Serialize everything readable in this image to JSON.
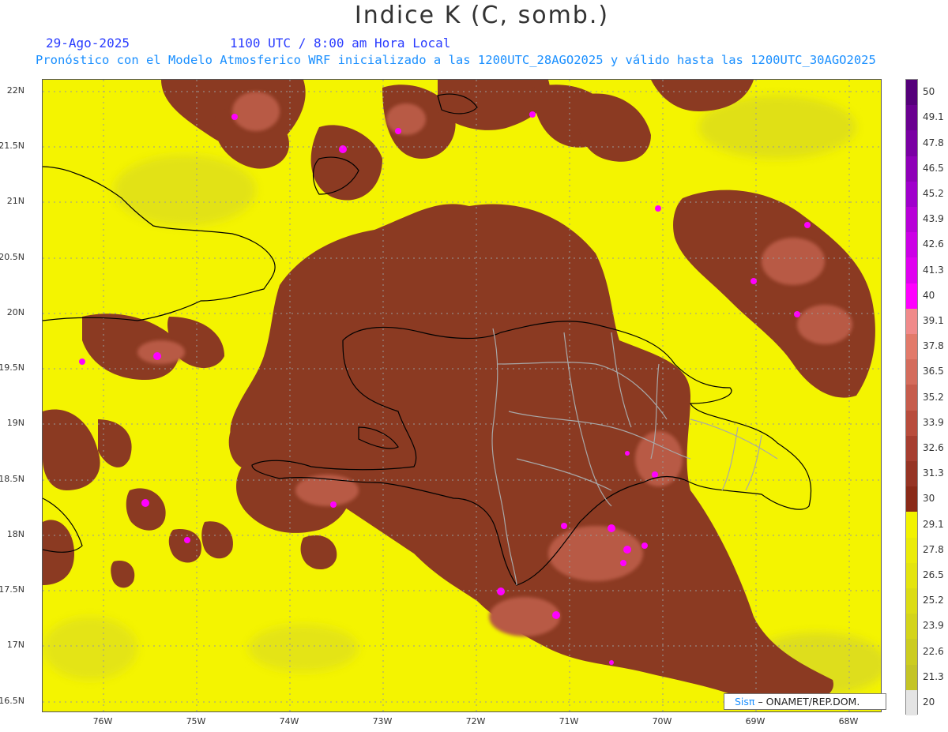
{
  "header": {
    "title": "Indice K (C, somb.)",
    "date": "29-Ago-2025",
    "time": "1100 UTC / 8:00 am Hora Local",
    "forecast_info": "Pronóstico con el Modelo Atmosferico WRF inicializado a las 1200UTC_28AGO2025 y válido hasta las  1200UTC_30AGO2025"
  },
  "map": {
    "lat_labels": [
      "22N",
      "21.5N",
      "21N",
      "20.5N",
      "20N",
      "19.5N",
      "19N",
      "18.5N",
      "18N",
      "17.5N",
      "17N",
      "16.5N"
    ],
    "lon_labels": [
      "76W",
      "75W",
      "74W",
      "73W",
      "72W",
      "71W",
      "70W",
      "69W",
      "68W"
    ],
    "colors": {
      "background_low": "#f4f400",
      "background_mid": "#d8d820",
      "high": "#8b3a22",
      "higher": "#b85a45",
      "extreme": "#ff00ff",
      "coast": "#000000",
      "borders": "#aaaaaa"
    }
  },
  "colorbar": {
    "labels": [
      "50",
      "49.1",
      "47.8",
      "46.5",
      "45.2",
      "43.9",
      "42.6",
      "41.3",
      "40",
      "39.1",
      "37.8",
      "36.5",
      "35.2",
      "33.9",
      "32.6",
      "31.3",
      "30",
      "29.1",
      "27.8",
      "26.5",
      "25.2",
      "23.9",
      "22.6",
      "21.3",
      "20"
    ],
    "colors": [
      "#55007a",
      "#6a0090",
      "#7a00a3",
      "#8f00b8",
      "#a000cc",
      "#b800d8",
      "#cc00e6",
      "#e000f0",
      "#ff00ff",
      "#f08a8a",
      "#e27a6a",
      "#d46c5c",
      "#c65c4c",
      "#b84c3c",
      "#a63e30",
      "#963424",
      "#8a2a18",
      "#f2f200",
      "#ebeb08",
      "#e4e40e",
      "#dcdc14",
      "#d4d41a",
      "#cccc20",
      "#c4c426",
      "#e4e4e4"
    ]
  },
  "credit": {
    "brand": "Sisπ",
    "text": "– ONAMET/REP.DOM."
  }
}
